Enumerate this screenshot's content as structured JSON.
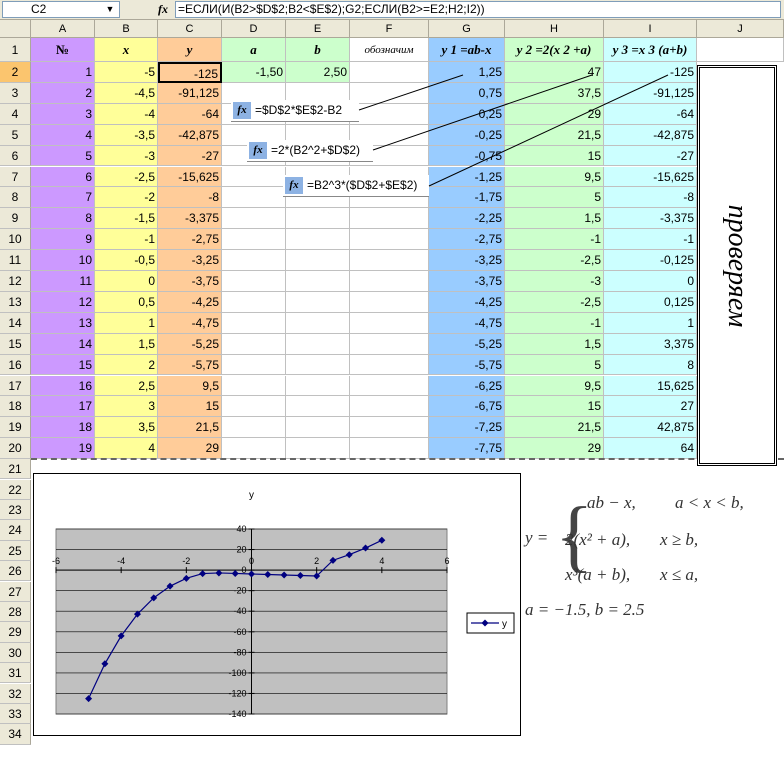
{
  "formula_bar": {
    "name_box": "C2",
    "fx": "fx",
    "formula": "=ЕСЛИ(И(B2>$D$2;B2<$E$2);G2;ЕСЛИ(B2>=E2;H2;I2))"
  },
  "columns": [
    "A",
    "B",
    "C",
    "D",
    "E",
    "F",
    "G",
    "H",
    "I",
    "J"
  ],
  "headers": {
    "A": "№",
    "B": "x",
    "C": "y",
    "D": "a",
    "E": "b",
    "F": "обозначим",
    "G": "y 1 =ab-x",
    "H": "y 2 =2(x 2 +a)",
    "I": "y 3 =x 3 (a+b)"
  },
  "params": {
    "a": "-1,50",
    "b": "2,50"
  },
  "rows": [
    {
      "n": "1",
      "x": "-5",
      "y": "-125",
      "g": "1,25",
      "h": "47",
      "i": "-125"
    },
    {
      "n": "2",
      "x": "-4,5",
      "y": "-91,125",
      "g": "0,75",
      "h": "37,5",
      "i": "-91,125"
    },
    {
      "n": "3",
      "x": "-4",
      "y": "-64",
      "g": "0,25",
      "h": "29",
      "i": "-64"
    },
    {
      "n": "4",
      "x": "-3,5",
      "y": "-42,875",
      "g": "-0,25",
      "h": "21,5",
      "i": "-42,875"
    },
    {
      "n": "5",
      "x": "-3",
      "y": "-27",
      "g": "-0,75",
      "h": "15",
      "i": "-27"
    },
    {
      "n": "6",
      "x": "-2,5",
      "y": "-15,625",
      "g": "-1,25",
      "h": "9,5",
      "i": "-15,625"
    },
    {
      "n": "7",
      "x": "-2",
      "y": "-8",
      "g": "-1,75",
      "h": "5",
      "i": "-8"
    },
    {
      "n": "8",
      "x": "-1,5",
      "y": "-3,375",
      "g": "-2,25",
      "h": "1,5",
      "i": "-3,375"
    },
    {
      "n": "9",
      "x": "-1",
      "y": "-2,75",
      "g": "-2,75",
      "h": "-1",
      "i": "-1"
    },
    {
      "n": "10",
      "x": "-0,5",
      "y": "-3,25",
      "g": "-3,25",
      "h": "-2,5",
      "i": "-0,125"
    },
    {
      "n": "11",
      "x": "0",
      "y": "-3,75",
      "g": "-3,75",
      "h": "-3",
      "i": "0"
    },
    {
      "n": "12",
      "x": "0,5",
      "y": "-4,25",
      "g": "-4,25",
      "h": "-2,5",
      "i": "0,125"
    },
    {
      "n": "13",
      "x": "1",
      "y": "-4,75",
      "g": "-4,75",
      "h": "-1",
      "i": "1"
    },
    {
      "n": "14",
      "x": "1,5",
      "y": "-5,25",
      "g": "-5,25",
      "h": "1,5",
      "i": "3,375"
    },
    {
      "n": "15",
      "x": "2",
      "y": "-5,75",
      "g": "-5,75",
      "h": "5",
      "i": "8"
    },
    {
      "n": "16",
      "x": "2,5",
      "y": "9,5",
      "g": "-6,25",
      "h": "9,5",
      "i": "15,625"
    },
    {
      "n": "17",
      "x": "3",
      "y": "15",
      "g": "-6,75",
      "h": "15",
      "i": "27"
    },
    {
      "n": "18",
      "x": "3,5",
      "y": "21,5",
      "g": "-7,25",
      "h": "21,5",
      "i": "42,875"
    },
    {
      "n": "19",
      "x": "4",
      "y": "29",
      "g": "-7,75",
      "h": "29",
      "i": "64"
    }
  ],
  "row_numbers": [
    "1",
    "2",
    "3",
    "4",
    "5",
    "6",
    "7",
    "8",
    "9",
    "10",
    "11",
    "12",
    "13",
    "14",
    "15",
    "16",
    "17",
    "18",
    "19",
    "20",
    "21",
    "22",
    "23",
    "24",
    "25",
    "26",
    "27",
    "28",
    "29",
    "30",
    "31",
    "32",
    "33",
    "34"
  ],
  "callouts": [
    {
      "fx": "fx",
      "text": "=$D$2*$E$2-B2"
    },
    {
      "fx": "fx",
      "text": "=2*(B2^2+$D$2)"
    },
    {
      "fx": "fx",
      "text": "=B2^3*($D$2+$E$2)"
    }
  ],
  "checkbox_label": "проверяем",
  "math": {
    "lhs": "y =",
    "case1_expr": "ab − x,",
    "case1_cond": "a < x < b,",
    "case2_expr": "2(x² + a),",
    "case2_cond": "x ≥ b,",
    "case3_expr": "x³(a + b),",
    "case3_cond": "x ≤ a,",
    "params": "a = −1.5, b = 2.5"
  },
  "colors": {
    "col_a": "#cc99ff",
    "col_b": "#ffff99",
    "col_c": "#ffcc99",
    "col_de": "#ccffcc",
    "col_g": "#99ccff",
    "col_h": "#ccffcc",
    "col_i": "#ccffff",
    "series": "#000080",
    "plot_bg": "#c0c0c0"
  },
  "chart_data": {
    "type": "line",
    "title": "y",
    "series": [
      {
        "name": "y",
        "x": [
          -5,
          -4.5,
          -4,
          -3.5,
          -3,
          -2.5,
          -2,
          -1.5,
          -1,
          -0.5,
          0,
          0.5,
          1,
          1.5,
          2,
          2.5,
          3,
          3.5,
          4
        ],
        "y": [
          -125,
          -91.125,
          -64,
          -42.875,
          -27,
          -15.625,
          -8,
          -3.375,
          -2.75,
          -3.25,
          -3.75,
          -4.25,
          -4.75,
          -5.25,
          -5.75,
          9.5,
          15,
          21.5,
          29
        ]
      }
    ],
    "xlim": [
      -6,
      6
    ],
    "ylim": [
      -140,
      40
    ],
    "xticks": [
      "-6",
      "-4",
      "-2",
      "0",
      "2",
      "4",
      "6"
    ],
    "yticks": [
      "40",
      "20",
      "0",
      "-20",
      "-40",
      "-60",
      "-80",
      "-100",
      "-120",
      "-140"
    ],
    "legend": "right",
    "grid": true
  }
}
